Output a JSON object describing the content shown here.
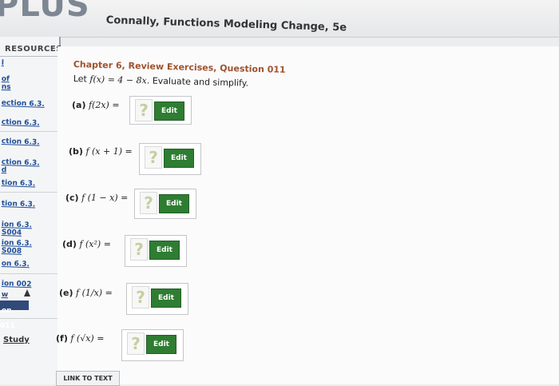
{
  "app": {
    "logo": "PLUS",
    "book_title": "Connally, Functions Modeling Change, 5e"
  },
  "sidebar": {
    "heading": "RESOURCES",
    "items": [
      "l",
      "of",
      "ns",
      "ection 6.3.",
      "ction 6.3.",
      "ction 6.3.",
      "ction 6.3.",
      "d",
      "tion 6.3.",
      "tion 6.3.",
      "ion 6.3.",
      "S004",
      "ion 6.3.",
      "S008",
      "on 6.3.",
      "ion 002",
      "w",
      "on 011"
    ],
    "study": "Study"
  },
  "question": {
    "chapter": "Chapter 6, Review Exercises, Question 011",
    "prompt_prefix": "Let",
    "function": "f(x) = 4 − 8x.",
    "prompt_suffix": "Evaluate and simplify.",
    "parts": [
      {
        "label": "(a)",
        "expr": "f(2x) ="
      },
      {
        "label": "(b)",
        "expr": "f (x + 1) ="
      },
      {
        "label": "(c)",
        "expr": "f (1 − x) ="
      },
      {
        "label": "(d)",
        "expr": "f (x²) ="
      },
      {
        "label": "(e)",
        "expr": "f (1/x) ="
      },
      {
        "label": "(f)",
        "expr": "f (√x) ="
      }
    ],
    "placeholder_symbol": "?",
    "edit_label": "Edit",
    "link_button": "LINK TO TEXT"
  }
}
